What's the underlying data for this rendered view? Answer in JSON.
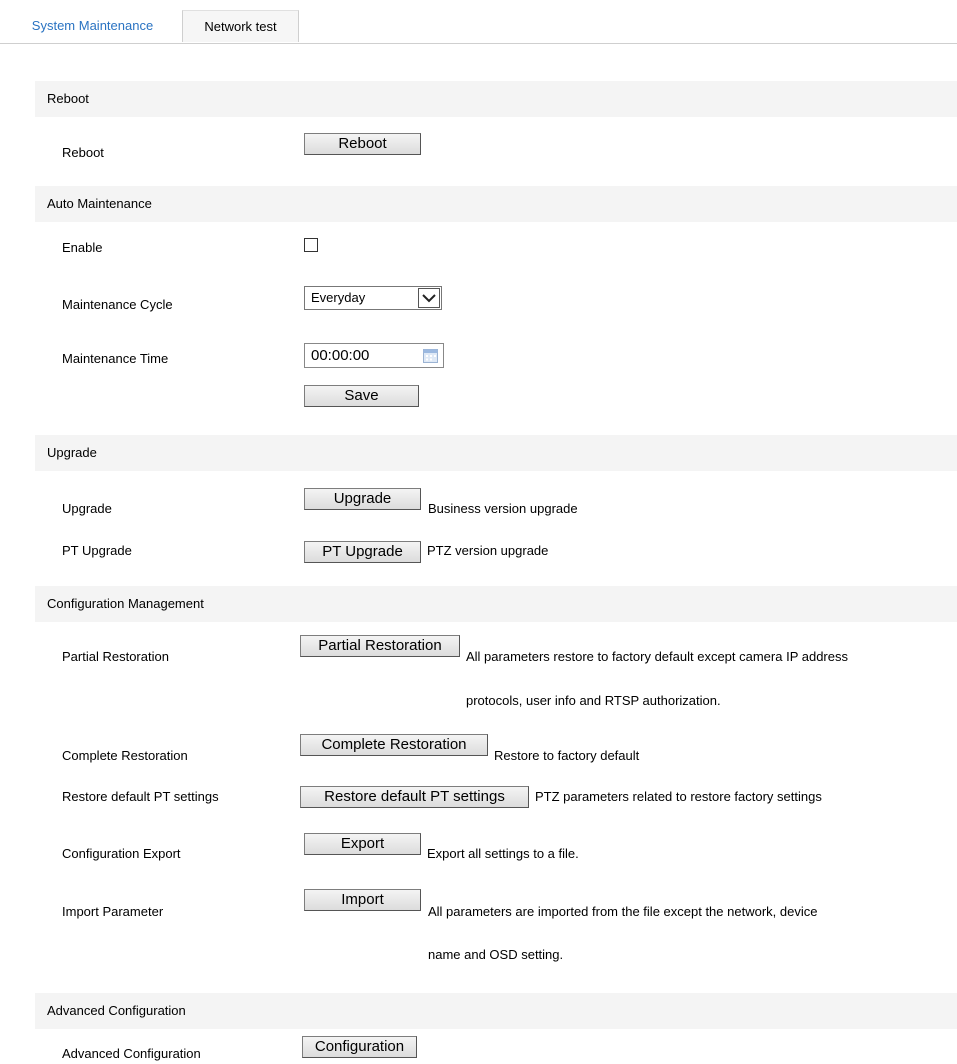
{
  "tabs": [
    {
      "label": "System Maintenance",
      "active": true
    },
    {
      "label": "Network test",
      "active": false
    }
  ],
  "reboot": {
    "header": "Reboot",
    "label": "Reboot",
    "button": "Reboot"
  },
  "auto_maintenance": {
    "header": "Auto Maintenance",
    "enable_label": "Enable",
    "enable_checked": false,
    "cycle_label": "Maintenance Cycle",
    "cycle_value": "Everyday",
    "time_label": "Maintenance Time",
    "time_value": "00:00:00",
    "save_button": "Save"
  },
  "upgrade": {
    "header": "Upgrade",
    "upgrade_label": "Upgrade",
    "upgrade_button": "Upgrade",
    "upgrade_desc": "Business version upgrade",
    "pt_label": "PT Upgrade",
    "pt_button": "PT Upgrade",
    "pt_desc": "PTZ version upgrade"
  },
  "config": {
    "header": "Configuration Management",
    "partial_label": "Partial Restoration",
    "partial_button": "Partial Restoration",
    "partial_desc_1": "All parameters restore to factory default except camera IP address",
    "partial_desc_2": "protocols, user info and RTSP authorization.",
    "complete_label": "Complete Restoration",
    "complete_button": "Complete Restoration",
    "complete_desc": "Restore to factory default",
    "restore_pt_label": "Restore default PT settings",
    "restore_pt_button": "Restore default PT settings",
    "restore_pt_desc": "PTZ parameters related to restore factory settings",
    "export_label": "Configuration Export",
    "export_button": "Export",
    "export_desc": "Export all settings to a file.",
    "import_label": "Import Parameter",
    "import_button": "Import",
    "import_desc_1": "All parameters are imported from the file except the network, device",
    "import_desc_2": "name and OSD setting."
  },
  "advanced": {
    "header": "Advanced Configuration",
    "label": "Advanced Configuration",
    "button": "Configuration"
  },
  "colors": {
    "active_tab": "#2a73c2",
    "section_bg": "#f4f4f4"
  }
}
